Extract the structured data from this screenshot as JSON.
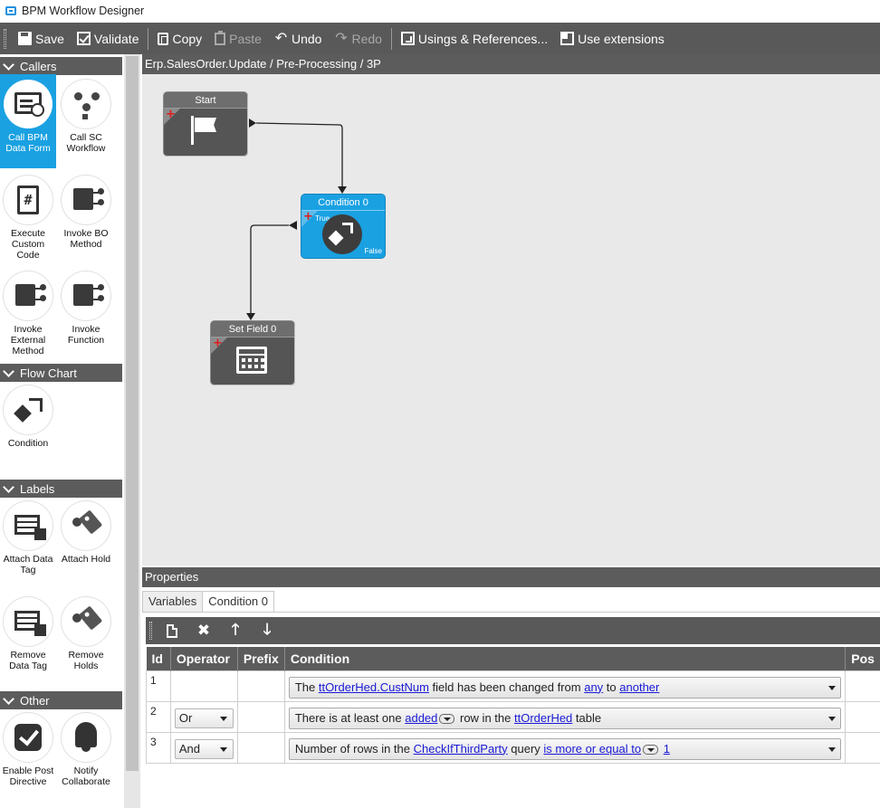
{
  "window": {
    "title": "BPM Workflow Designer"
  },
  "toolbar": {
    "save": "Save",
    "validate": "Validate",
    "copy": "Copy",
    "paste": "Paste",
    "undo": "Undo",
    "redo": "Redo",
    "usings": "Usings & References...",
    "extensions": "Use extensions"
  },
  "toolbox": {
    "groups": [
      {
        "header": "Callers",
        "items": [
          "Call BPM Data Form",
          "Call SC Workflow",
          "Execute Custom Code",
          "Invoke BO Method",
          "Invoke External Method",
          "Invoke Function"
        ]
      },
      {
        "header": "Flow Chart",
        "items": [
          "Condition"
        ]
      },
      {
        "header": "Labels",
        "items": [
          "Attach Data Tag",
          "Attach Hold",
          "Remove Data Tag",
          "Remove Holds"
        ]
      },
      {
        "header": "Other",
        "items": [
          "Enable Post Directive",
          "Notify Collaborate"
        ]
      }
    ],
    "selected": "Call BPM Data Form"
  },
  "canvas": {
    "breadcrumb": "Erp.SalesOrder.Update / Pre-Processing / 3P",
    "nodes": {
      "start": {
        "title": "Start"
      },
      "condition": {
        "title": "Condition 0",
        "true_label": "True",
        "false_label": "False"
      },
      "setfield": {
        "title": "Set Field 0"
      }
    }
  },
  "properties": {
    "header": "Properties",
    "tabs": [
      "Variables",
      "Condition 0"
    ],
    "active_tab": "Condition 0",
    "columns": [
      "Id",
      "Operator",
      "Prefix",
      "Condition",
      "Pos"
    ],
    "rows": [
      {
        "id": "1",
        "operator": "",
        "prefix": "",
        "c": {
          "t1": "The ",
          "l1": "ttOrderHed.CustNum",
          "t2": " field has been changed from ",
          "l2": "any",
          "t3": " to ",
          "l3": "another"
        }
      },
      {
        "id": "2",
        "operator": "Or",
        "prefix": "",
        "c": {
          "t1": "There is at least one ",
          "l1": "added",
          "t2": " row in the ",
          "l2": "ttOrderHed",
          "t3": " table"
        }
      },
      {
        "id": "3",
        "operator": "And",
        "prefix": "",
        "c": {
          "t1": "Number of rows in the ",
          "l1": "CheckIfThirdParty",
          "t2": " query ",
          "l2": "is more or equal to",
          "l3": "1"
        }
      }
    ]
  }
}
